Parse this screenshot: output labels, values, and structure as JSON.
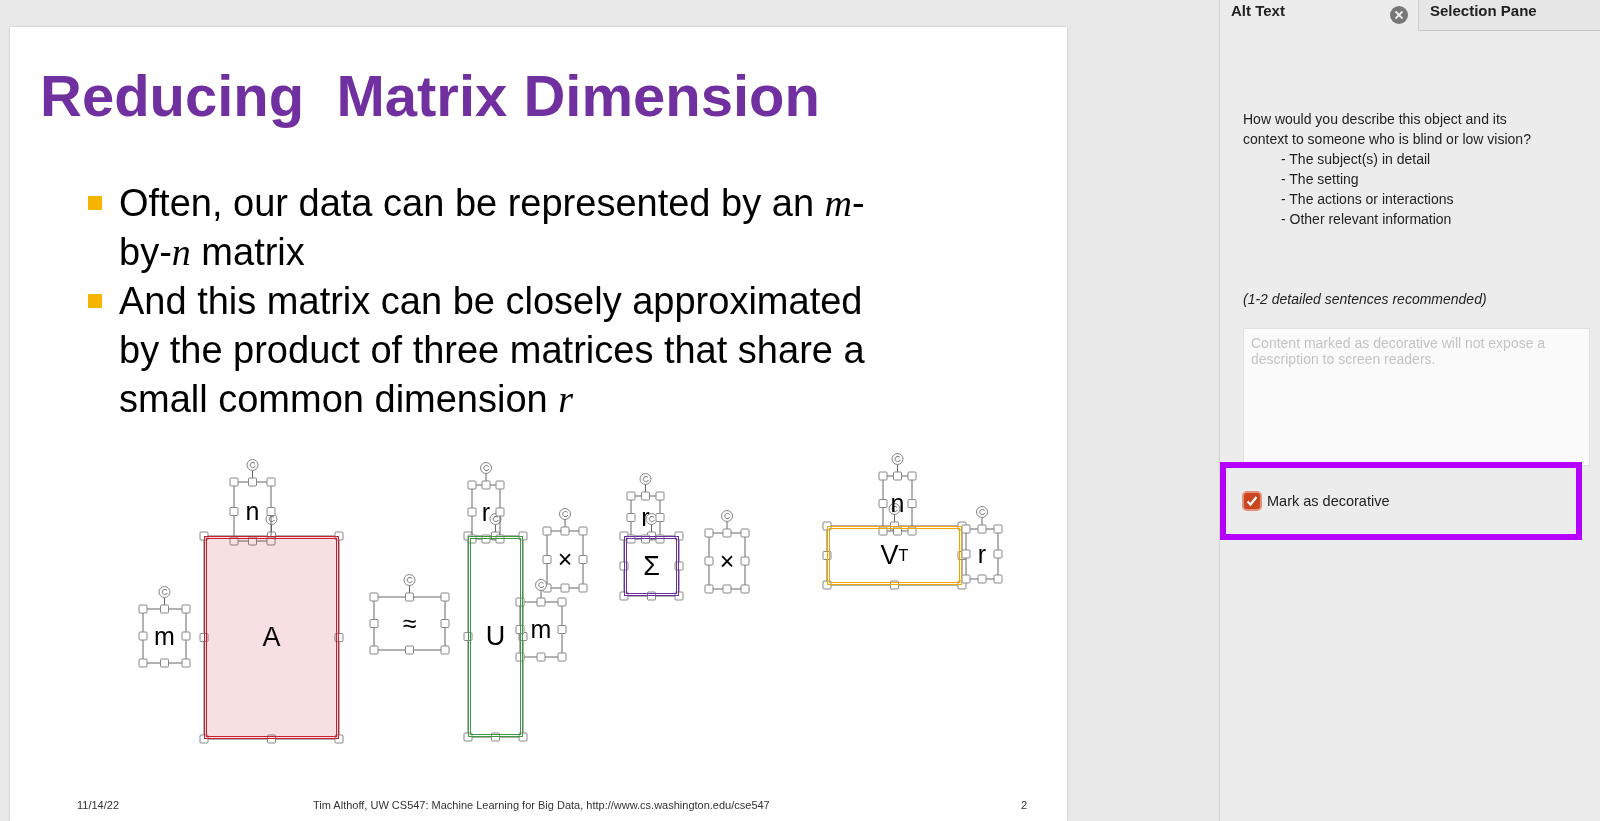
{
  "slide": {
    "title": "Reducing  Matrix Dimension",
    "bullets": [
      "Often, our data can be represented by an *m*-by-*n* matrix",
      "And this matrix can be closely approximated by the product of three matrices that share a small common dimension *r*"
    ],
    "diagram": [
      {
        "kind": "label",
        "text": "m"
      },
      {
        "kind": "matrix",
        "text": "A",
        "color": "#c8202f",
        "filled": true
      },
      {
        "kind": "label",
        "text": "n"
      },
      {
        "kind": "label",
        "text": "≈"
      },
      {
        "kind": "matrix",
        "text": "U",
        "color": "#3f9a3f",
        "filled": false
      },
      {
        "kind": "label",
        "text": "r"
      },
      {
        "kind": "label",
        "text": "×"
      },
      {
        "kind": "label",
        "text": "m"
      },
      {
        "kind": "matrix",
        "text": "Σ",
        "color": "#6a2fa0",
        "filled": false
      },
      {
        "kind": "label",
        "text": "r"
      },
      {
        "kind": "label",
        "text": "×"
      },
      {
        "kind": "matrix",
        "text": "V$^{T}$",
        "color": "#f0a800",
        "filled": false
      },
      {
        "kind": "label",
        "text": "n"
      },
      {
        "kind": "label",
        "text": "r"
      }
    ],
    "footer": {
      "date": "11/14/22",
      "text": "Tim Althoff, UW CS547: Machine Learning for Big Data, http://www.cs.washington.edu/cse547",
      "page": "2"
    }
  },
  "panel": {
    "tabs": [
      {
        "label": "Alt Text",
        "selected": true
      },
      {
        "label": "Selection Pane",
        "selected": false
      }
    ],
    "question": "How would you describe this object and its context to someone who is blind or low vision?",
    "prompts": [
      "- The subject(s) in detail",
      "- The setting",
      "- The actions or interactions",
      "- Other relevant information"
    ],
    "hint": "(1-2 detailed sentences recommended)",
    "description": {
      "placeholder": "Content marked as decorative will not expose a description to screen readers.",
      "disabled": true
    },
    "decorative": {
      "label": "Mark as decorative",
      "checked": true
    }
  }
}
